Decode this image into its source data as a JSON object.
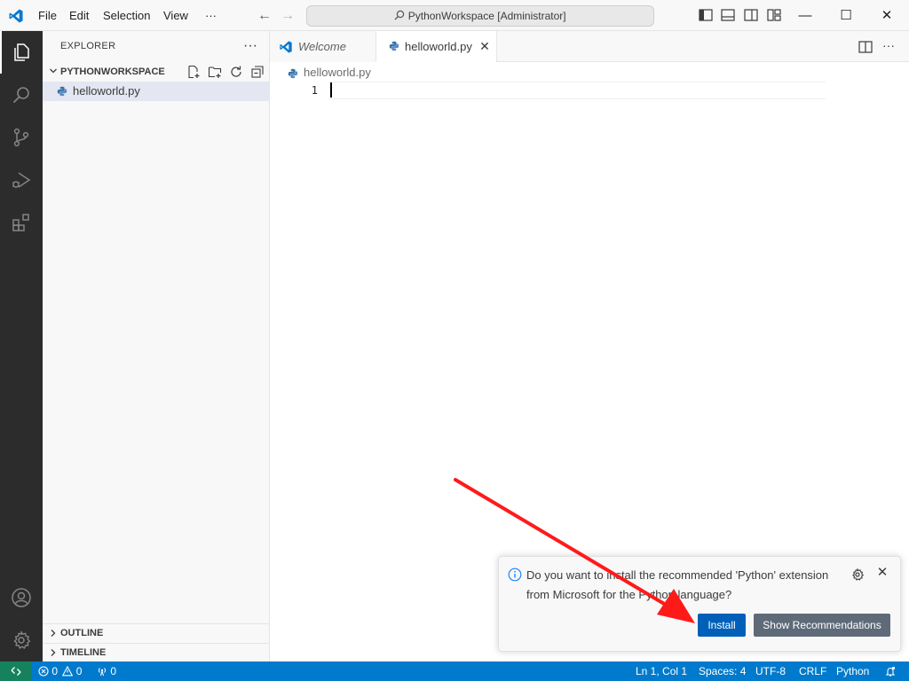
{
  "titlebar": {
    "menu": [
      "File",
      "Edit",
      "Selection",
      "View",
      "···"
    ],
    "search_text": "PythonWorkspace [Administrator]",
    "minimize": "—",
    "maximize": "☐",
    "close": "✕"
  },
  "sidebar": {
    "title": "EXPLORER",
    "more": "···",
    "workspace": "PYTHONWORKSPACE",
    "files": [
      "helloworld.py"
    ],
    "sections": [
      "OUTLINE",
      "TIMELINE"
    ]
  },
  "editor": {
    "tabs": [
      {
        "label": "Welcome",
        "active": false
      },
      {
        "label": "helloworld.py",
        "active": true
      }
    ],
    "breadcrumb": "helloworld.py",
    "line_number": "1"
  },
  "notification": {
    "message": "Do you want to install the recommended 'Python' extension from Microsoft for the Python language?",
    "install_label": "Install",
    "recommendations_label": "Show Recommendations"
  },
  "statusbar": {
    "errors": "0",
    "warnings": "0",
    "ports": "0",
    "position": "Ln 1, Col 1",
    "spaces": "Spaces: 4",
    "encoding": "UTF-8",
    "eol": "CRLF",
    "language": "Python"
  },
  "colors": {
    "accent": "#007acc",
    "install_button": "#005fb8",
    "annotation_arrow": "#ff1a1a"
  }
}
